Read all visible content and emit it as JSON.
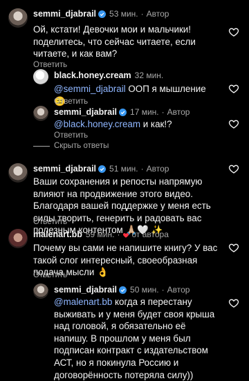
{
  "comments": [
    {
      "user": "semmi_djabrail",
      "time": "53 мин.",
      "role": "Автор",
      "text": "Ой, кстати! Девочки мои и мальчики! поделитесь, что сейчас читаете, если читаете, и как вам?",
      "reply_label": "Ответить"
    },
    {
      "user": "black.honey.cream",
      "time": "32 мин.",
      "mention": "@semmi_djabrail",
      "text": " ООП я мышление 😑",
      "reply_label": "Ответить"
    },
    {
      "user": "semmi_djabrail",
      "time": "17 мин.",
      "role": "Автор",
      "mention": "@black.honey.cream",
      "text": " и как!?",
      "reply_label": "Ответить"
    },
    {
      "user": "semmi_djabrail",
      "time": "51 мин.",
      "role": "Автор",
      "text": "Ваши сохранения и репосты напрямую влияют на продвижение этого видео. Благодаря вашей поддержке у меня есть силы творить, генерить и радовать вас полезным контентом 🙏🏼🤍 ✨",
      "reply_label": "Ответить"
    },
    {
      "user": "malenart.bb",
      "time": "59 мин.",
      "liked_by": "от автора",
      "text": "Почему вы сами не напишите книгу? У вас такой слог интересный, своеобразная подача мысли 👌",
      "reply_label": "Ответить"
    },
    {
      "user": "semmi_djabrail",
      "time": "50 мин.",
      "role": "Автор",
      "mention": "@malenart.bb",
      "text": " когда я перестану выживать и у меня будет своя крыша над головой, я обязательно её напишу. В прошлом у меня был подписан контракт с издательством АСТ, но я покинула Россию и договорённость потеряла силу))"
    }
  ],
  "hide_replies_label": "Скрыть ответы",
  "dot": "·",
  "colors": {
    "background": "#000000",
    "text": "#f5f5f5",
    "muted": "#a8a8a8",
    "mention": "#8fb6ff",
    "verified": "#3897f0",
    "heart_red": "#ff3040"
  }
}
